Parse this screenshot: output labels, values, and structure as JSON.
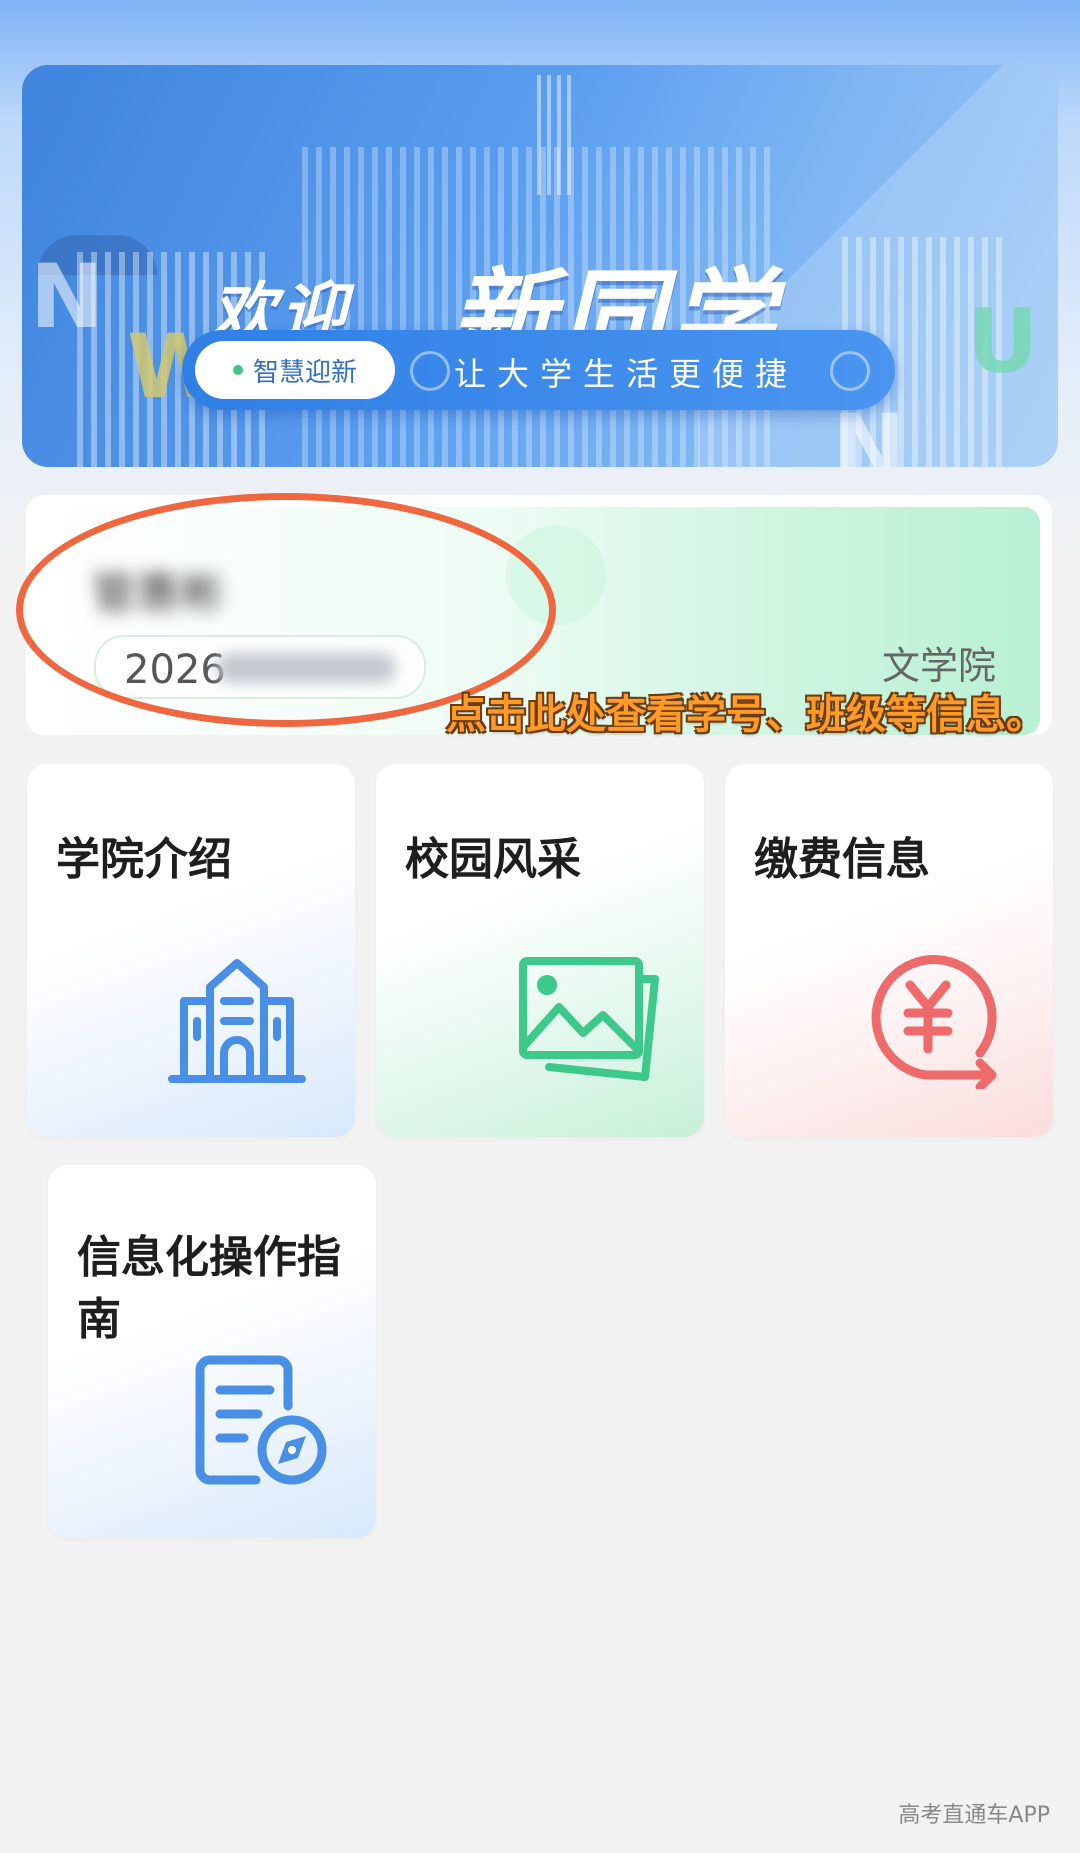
{
  "banner": {
    "welcome_small": "欢迎",
    "welcome_big": "新同学",
    "tag": "智慧迎新",
    "slogan": "让大学生活更便捷",
    "decor_letters": [
      "N",
      "W",
      "U",
      "N"
    ]
  },
  "student": {
    "name": "管惠彬",
    "id_prefix": "2026",
    "college": "文学院"
  },
  "annotation": {
    "text": "点击此处查看学号、班级等信息。"
  },
  "features": [
    {
      "label": "学院介绍",
      "icon": "building-icon",
      "color": "#4a8fe6"
    },
    {
      "label": "校园风采",
      "icon": "image-gallery-icon",
      "color": "#3cc98a"
    },
    {
      "label": "缴费信息",
      "icon": "yuan-payment-icon",
      "color": "#ef6a6a"
    },
    {
      "label": "信息化操作指南",
      "icon": "document-compass-icon",
      "color": "#4a8fe6"
    }
  ],
  "watermark": "高考直通车APP"
}
